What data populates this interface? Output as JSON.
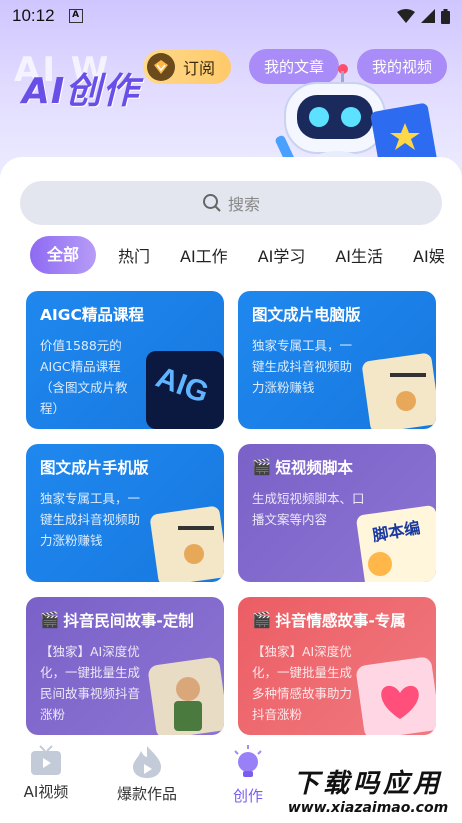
{
  "status_bar": {
    "time": "10:12",
    "notification_badge": "A"
  },
  "header": {
    "title": "AI创作",
    "title_shadow": "AI W",
    "subscribe_label": "订阅",
    "my_articles_label": "我的文章",
    "my_videos_label": "我的视频"
  },
  "search": {
    "placeholder": "搜索"
  },
  "tabs": [
    {
      "label": "全部",
      "active": true
    },
    {
      "label": "热门"
    },
    {
      "label": "AI工作"
    },
    {
      "label": "AI学习"
    },
    {
      "label": "AI生活"
    },
    {
      "label": "AI娱"
    }
  ],
  "cards": [
    {
      "title": "AIGC精品课程",
      "desc": "价值1588元的AIGC精品课程（含图文成片教程）",
      "color": "#1f88ee"
    },
    {
      "title": "图文成片电脑版",
      "desc": "独家专属工具，一键生成抖音视频助力涨粉赚钱",
      "color": "#1f88ee"
    },
    {
      "title": "图文成片手机版",
      "desc": "独家专属工具，一键生成抖音视频助力涨粉赚钱",
      "color": "#1f88ee"
    },
    {
      "title": "短视频脚本",
      "desc": "生成短视频脚本、口播文案等内容",
      "color": "#7a61c8",
      "thumb_text": "脚本编"
    },
    {
      "title": "抖音民间故事-定制",
      "desc": "【独家】AI深度优化，一键批量生成民间故事视频抖音涨粉",
      "color": "#7a61c8"
    },
    {
      "title": "抖音情感故事-专属",
      "desc": "【独家】AI深度优化，一键批量生成多种情感故事助力抖音涨粉",
      "color": "#ec5d64"
    }
  ],
  "bottom_nav": [
    {
      "label": "AI视频",
      "icon": "tv-icon"
    },
    {
      "label": "爆款作品",
      "icon": "flame-icon"
    },
    {
      "label": "创作",
      "icon": "bulb-icon",
      "active": true
    }
  ],
  "watermark": {
    "big": "下载吗应用",
    "small": "www.xiazaimao.com"
  },
  "colors": {
    "accent": "#7a5cf0",
    "blue_card": "#1f88ee",
    "purple_card": "#7a61c8",
    "red_card": "#ec5d64"
  }
}
